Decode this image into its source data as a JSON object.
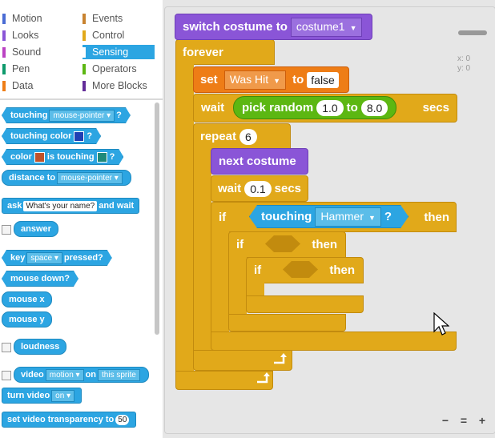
{
  "categories": [
    {
      "label": "Motion",
      "color": "#4a6cd4"
    },
    {
      "label": "Events",
      "color": "#c88330"
    },
    {
      "label": "Looks",
      "color": "#8a55d7"
    },
    {
      "label": "Control",
      "color": "#e1a91a"
    },
    {
      "label": "Sound",
      "color": "#bb42c3"
    },
    {
      "label": "Sensing",
      "color": "#2ca5e2",
      "selected": true
    },
    {
      "label": "Pen",
      "color": "#0e9a6c"
    },
    {
      "label": "Operators",
      "color": "#5cb712"
    },
    {
      "label": "Data",
      "color": "#ee7d16"
    },
    {
      "label": "More Blocks",
      "color": "#632d99"
    }
  ],
  "palette": {
    "touching": {
      "label": "touching",
      "menu": "mouse-pointer",
      "q": "?"
    },
    "touching_color": {
      "label": "touching color",
      "q": "?",
      "swatch": "#1f3fb4"
    },
    "color_touching": {
      "label1": "color",
      "label2": "is touching",
      "q": "?",
      "swatch1": "#c0522a",
      "swatch2": "#1f8a7a"
    },
    "distance": {
      "label": "distance to",
      "menu": "mouse-pointer"
    },
    "ask": {
      "label1": "ask",
      "value": "What's your name?",
      "label2": "and wait"
    },
    "answer": "answer",
    "key_pressed": {
      "label1": "key",
      "menu": "space",
      "label2": "pressed?"
    },
    "mouse_down": "mouse down?",
    "mouse_x": "mouse x",
    "mouse_y": "mouse y",
    "loudness": "loudness",
    "video": {
      "label1": "video",
      "menu1": "motion",
      "label2": "on",
      "menu2": "this sprite"
    },
    "turn_video": {
      "label": "turn video",
      "menu": "on"
    },
    "set_video": {
      "label": "set video transparency to",
      "value": "50"
    }
  },
  "sprite_info": {
    "x": "x: 0",
    "y": "y: 0"
  },
  "script": {
    "switch_costume": {
      "label": "switch costume to",
      "menu": "costume1"
    },
    "forever": "forever",
    "set": {
      "label": "set",
      "menu": "Was Hit",
      "to": "to",
      "value": "false"
    },
    "wait_random": {
      "wait": "wait",
      "pick": "pick random",
      "from": "1.0",
      "to": "to",
      "max": "8.0",
      "secs": "secs"
    },
    "repeat": {
      "label": "repeat",
      "value": "6"
    },
    "next_costume": "next costume",
    "wait": {
      "label": "wait",
      "value": "0.1",
      "secs": "secs"
    },
    "if1": {
      "if": "if",
      "touching": "touching",
      "menu": "Hammer",
      "q": "?",
      "then": "then"
    },
    "if2": {
      "if": "if",
      "then": "then"
    },
    "if3": {
      "if": "if",
      "then": "then"
    }
  },
  "zoom": {
    "out": "−",
    "reset": "=",
    "in": "+"
  }
}
